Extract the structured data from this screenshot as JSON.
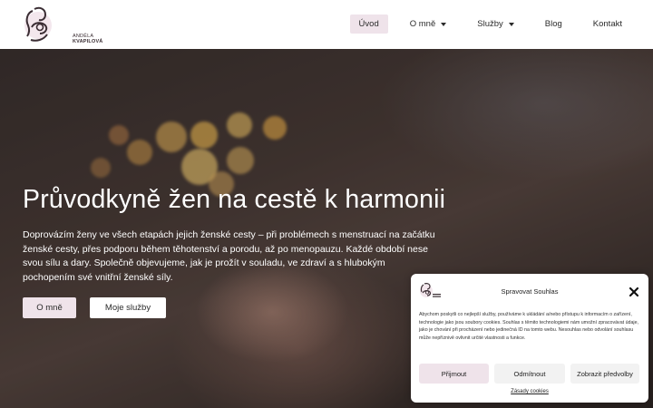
{
  "header": {
    "logo_line1": "ANDĚLA",
    "logo_line2": "KVAPILOVÁ",
    "nav": [
      {
        "label": "Úvod",
        "active": true
      },
      {
        "label": "O mně",
        "dropdown": true
      },
      {
        "label": "Služby",
        "dropdown": true
      },
      {
        "label": "Blog"
      },
      {
        "label": "Kontakt"
      }
    ]
  },
  "hero": {
    "title": "Průvodkyně žen na cestě k harmonii",
    "text": "Doprovázím ženy ve všech etapách jejich ženské cesty – při problémech s menstruací na začátku ženské cesty, přes podporu během těhotenství a porodu, až po menopauzu. Každé období nese svou sílu a dary. Společně objevujeme, jak je prožít v souladu, ve zdraví a s hlubokým pochopením své vnitřní ženské síly.",
    "button_about": "O mně",
    "button_services": "Moje služby"
  },
  "consent": {
    "title": "Spravovat Souhlas",
    "body": "Abychom poskytli co nejlepší služby, používáme k ukládání a/nebo přístupu k informacím o zařízení, technologie jako jsou soubory cookies. Souhlas s těmito technologiemi nám umožní zpracovávat údaje, jako je chování při procházení nebo jedinečná ID na tomto webu. Nesouhlas nebo odvolání souhlasu může nepříznivě ovlivnit určité vlastnosti a funkce.",
    "accept": "Přijmout",
    "deny": "Odmítnout",
    "prefs": "Zobrazit předvolby",
    "link": "Zásady cookies"
  },
  "colors": {
    "accent": "#efe3ea"
  }
}
